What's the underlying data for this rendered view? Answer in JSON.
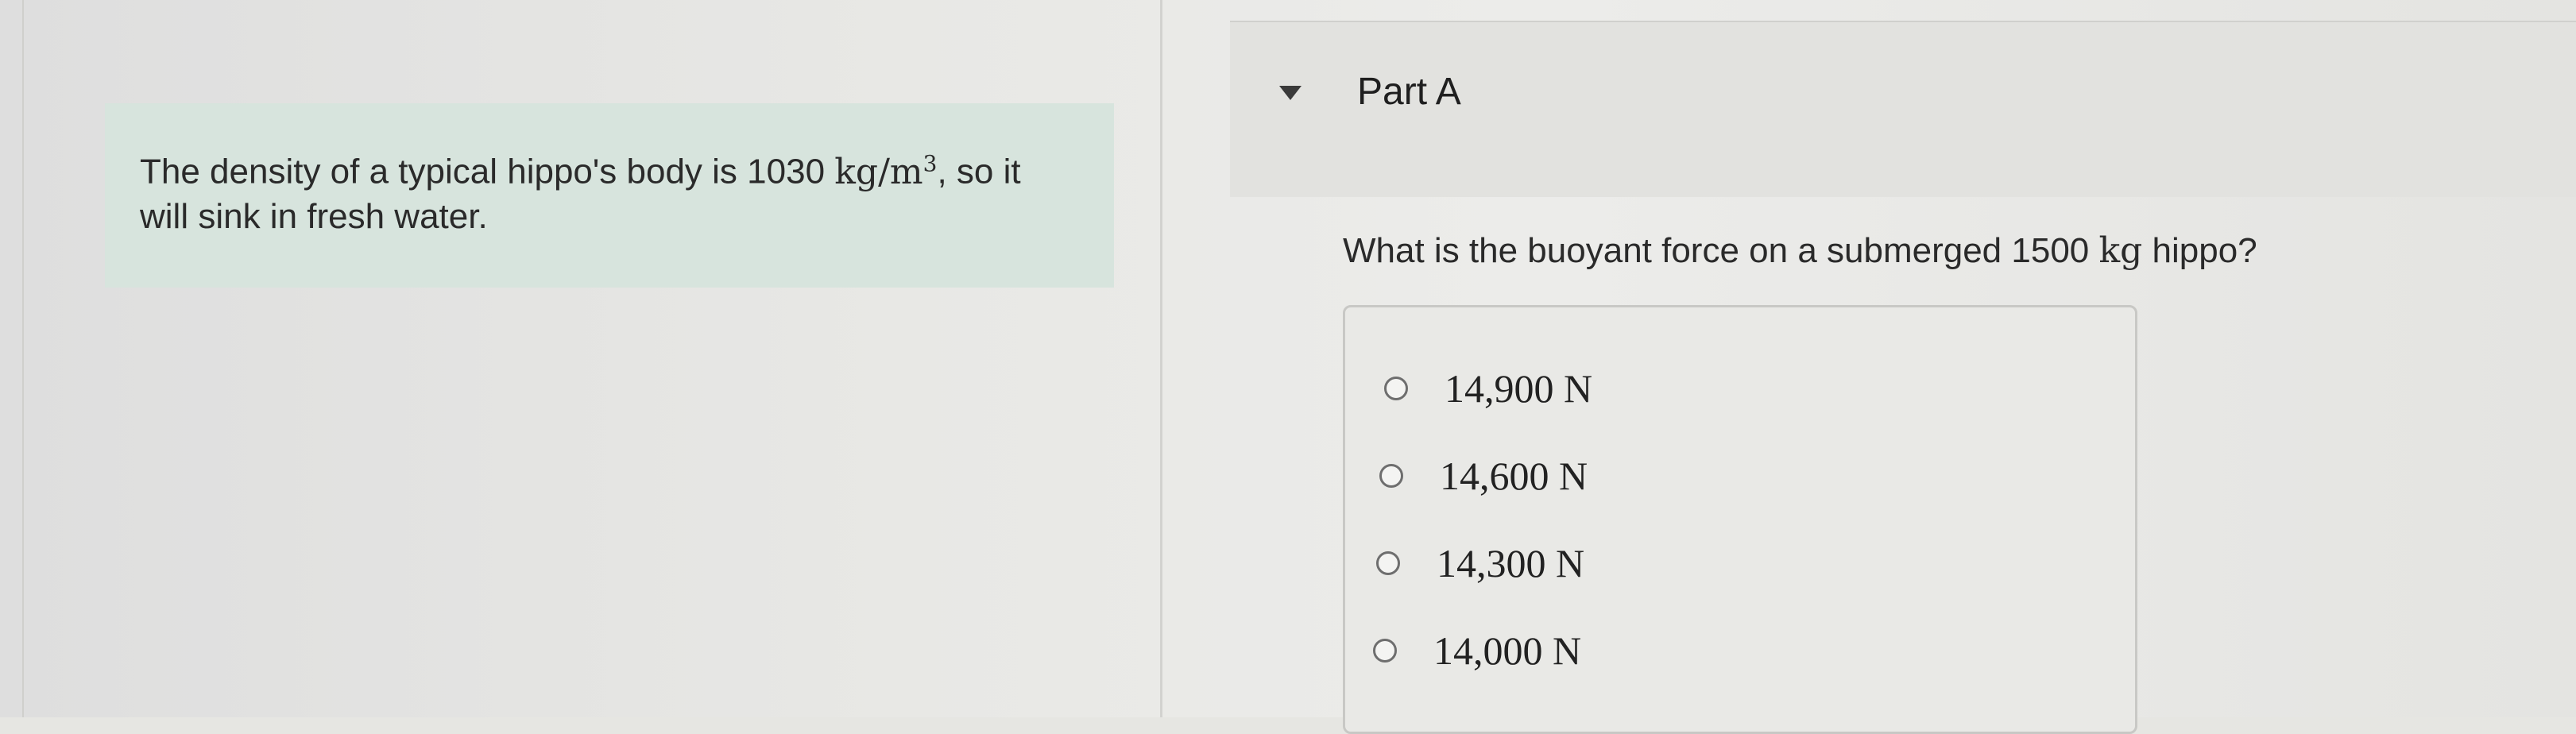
{
  "intro": {
    "text_before": "The density of a typical hippo's body is 1030 ",
    "unit_base": "kg/m",
    "unit_exponent": "3",
    "text_after": ", so it",
    "line2": "will sink in fresh water."
  },
  "part": {
    "title": "Part A"
  },
  "question": {
    "text_before": "What is the buoyant force on a submerged 1500 ",
    "unit": "kg",
    "text_after": " hippo?"
  },
  "choices": [
    {
      "label": "14,900 N",
      "selected": false
    },
    {
      "label": "14,600 N",
      "selected": false
    },
    {
      "label": "14,300 N",
      "selected": false
    },
    {
      "label": "14,000 N",
      "selected": false
    }
  ],
  "icons": {
    "collapse": "caret-down-icon",
    "option": "radio-circle-icon"
  }
}
